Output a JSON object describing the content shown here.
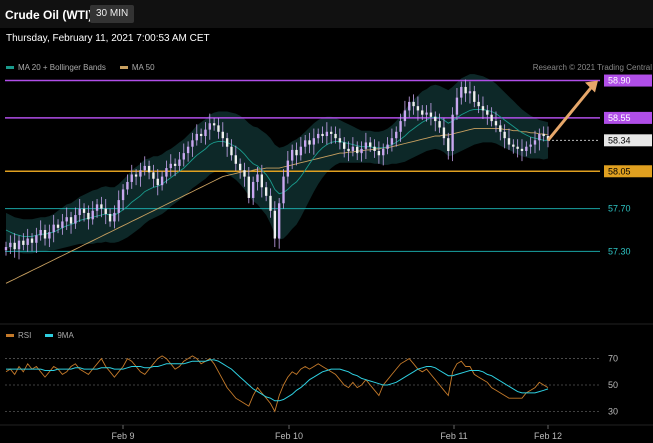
{
  "header": {
    "title": "Crude Oil (WTI)",
    "timeframe": "30 MIN"
  },
  "datetime": "Thursday, February 11, 2021 7:00:53 AM CET",
  "credit": "Research © 2021 Trading Central",
  "legend_main": [
    {
      "label": "MA 20 + Bollinger Bands",
      "color": "#1a9a8c"
    },
    {
      "label": "MA 50",
      "color": "#c8a060"
    }
  ],
  "legend_rsi": [
    {
      "label": "RSI",
      "color": "#c47a2a"
    },
    {
      "label": "9MA",
      "color": "#2ecfe0"
    }
  ],
  "colors": {
    "candle": "#c9a7f0",
    "resistance": "#b04ee8",
    "support_strong": "#e0a020",
    "support": "#1aa5a5",
    "target_arrow": "#e6a76a",
    "bands": "#0f2f2f"
  },
  "chart_data": [
    {
      "type": "candlestick",
      "x_ticks": [
        "Feb 9",
        "Feb 10",
        "Feb 11",
        "Feb 12"
      ],
      "ylim": [
        57.2,
        58.98
      ],
      "levels": [
        {
          "value": 58.9,
          "label": "58.90",
          "kind": "resistance"
        },
        {
          "value": 58.55,
          "label": "58.55",
          "kind": "resistance"
        },
        {
          "value": 58.05,
          "label": "58.05",
          "kind": "support_strong"
        },
        {
          "value": 57.7,
          "label": "57.70",
          "kind": "support"
        },
        {
          "value": 57.3,
          "label": "57.30",
          "kind": "support"
        }
      ],
      "last_price": {
        "value": 58.34,
        "label": "58.34"
      },
      "close": [
        57.34,
        57.38,
        57.32,
        57.4,
        57.36,
        57.42,
        57.38,
        57.45,
        57.5,
        57.42,
        57.48,
        57.55,
        57.52,
        57.58,
        57.62,
        57.56,
        57.64,
        57.7,
        57.66,
        57.6,
        57.68,
        57.74,
        57.7,
        57.65,
        57.58,
        57.66,
        57.78,
        57.88,
        57.95,
        58.02,
        58.0,
        58.06,
        58.1,
        58.04,
        57.98,
        57.92,
        58.0,
        58.08,
        58.12,
        58.1,
        58.16,
        58.22,
        58.28,
        58.34,
        58.4,
        58.38,
        58.44,
        58.5,
        58.48,
        58.42,
        58.36,
        58.28,
        58.2,
        58.12,
        58.06,
        58.0,
        57.8,
        57.95,
        58.02,
        57.9,
        57.82,
        57.68,
        57.42,
        57.75,
        58.0,
        58.15,
        58.25,
        58.2,
        58.28,
        58.34,
        58.3,
        58.36,
        58.4,
        58.38,
        58.42,
        58.4,
        58.36,
        58.32,
        58.26,
        58.24,
        58.28,
        58.22,
        58.26,
        58.32,
        58.28,
        58.24,
        58.2,
        58.26,
        58.3,
        58.36,
        58.42,
        58.52,
        58.62,
        58.7,
        58.66,
        58.62,
        58.58,
        58.6,
        58.56,
        58.52,
        58.46,
        58.36,
        58.24,
        58.58,
        58.74,
        58.84,
        58.78,
        58.8,
        58.7,
        58.66,
        58.62,
        58.58,
        58.52,
        58.48,
        58.42,
        58.36,
        58.3,
        58.28,
        58.26,
        58.24,
        58.28,
        58.3,
        58.34,
        58.4,
        58.38,
        58.34
      ],
      "ma20": [
        57.5,
        57.48,
        57.46,
        57.45,
        57.44,
        57.44,
        57.44,
        57.45,
        57.46,
        57.46,
        57.47,
        57.48,
        57.5,
        57.52,
        57.54,
        57.55,
        57.57,
        57.59,
        57.6,
        57.61,
        57.62,
        57.63,
        57.64,
        57.65,
        57.64,
        57.64,
        57.66,
        57.69,
        57.72,
        57.76,
        57.79,
        57.82,
        57.86,
        57.88,
        57.9,
        57.91,
        57.93,
        57.96,
        57.99,
        58.02,
        58.05,
        58.08,
        58.12,
        58.16,
        58.2,
        58.23,
        58.26,
        58.3,
        58.32,
        58.33,
        58.33,
        58.32,
        58.3,
        58.28,
        58.25,
        58.21,
        58.16,
        58.12,
        58.1,
        58.06,
        58.02,
        57.96,
        57.88,
        57.84,
        57.85,
        57.88,
        57.92,
        57.95,
        58.0,
        58.06,
        58.12,
        58.18,
        58.23,
        58.27,
        58.3,
        58.32,
        58.33,
        58.33,
        58.32,
        58.31,
        58.3,
        58.29,
        58.28,
        58.28,
        58.28,
        58.27,
        58.27,
        58.27,
        58.28,
        58.3,
        58.32,
        58.35,
        58.38,
        58.42,
        58.45,
        58.48,
        58.51,
        58.53,
        58.55,
        58.56,
        58.55,
        58.53,
        58.5,
        58.52,
        58.55,
        58.58,
        58.6,
        58.62,
        58.63,
        58.63,
        58.63,
        58.62,
        58.61,
        58.59,
        58.56,
        58.53,
        58.5,
        58.47,
        58.44,
        58.41,
        58.39,
        58.37,
        58.36,
        58.35,
        58.34,
        58.34
      ],
      "ma50": [
        57.0,
        57.02,
        57.04,
        57.06,
        57.08,
        57.1,
        57.12,
        57.14,
        57.16,
        57.18,
        57.2,
        57.22,
        57.24,
        57.26,
        57.28,
        57.3,
        57.32,
        57.34,
        57.36,
        57.38,
        57.4,
        57.42,
        57.44,
        57.46,
        57.48,
        57.5,
        57.52,
        57.54,
        57.56,
        57.58,
        57.6,
        57.62,
        57.64,
        57.66,
        57.68,
        57.7,
        57.72,
        57.74,
        57.76,
        57.78,
        57.8,
        57.82,
        57.84,
        57.86,
        57.88,
        57.9,
        57.92,
        57.94,
        57.96,
        57.98,
        58.0,
        58.01,
        58.02,
        58.03,
        58.04,
        58.05,
        58.05,
        58.06,
        58.07,
        58.07,
        58.08,
        58.08,
        58.08,
        58.08,
        58.09,
        58.1,
        58.11,
        58.12,
        58.13,
        58.14,
        58.15,
        58.16,
        58.17,
        58.18,
        58.19,
        58.2,
        58.21,
        58.22,
        58.22,
        58.23,
        58.23,
        58.24,
        58.24,
        58.25,
        58.25,
        58.26,
        58.26,
        58.27,
        58.27,
        58.28,
        58.29,
        58.3,
        58.31,
        58.32,
        58.33,
        58.34,
        58.35,
        58.36,
        58.37,
        58.38,
        58.38,
        58.39,
        58.39,
        58.4,
        58.41,
        58.42,
        58.43,
        58.44,
        58.45,
        58.45,
        58.45,
        58.45,
        58.45,
        58.45,
        58.45,
        58.44,
        58.44,
        58.43,
        58.43,
        58.42,
        58.42,
        58.41,
        58.41,
        58.4,
        58.4,
        58.39
      ],
      "band_width": [
        0.16,
        0.16,
        0.16,
        0.16,
        0.16,
        0.16,
        0.16,
        0.16,
        0.16,
        0.16,
        0.16,
        0.17,
        0.18,
        0.19,
        0.2,
        0.2,
        0.21,
        0.22,
        0.23,
        0.24,
        0.25,
        0.25,
        0.26,
        0.26,
        0.26,
        0.26,
        0.27,
        0.28,
        0.29,
        0.3,
        0.3,
        0.3,
        0.3,
        0.29,
        0.29,
        0.28,
        0.28,
        0.28,
        0.27,
        0.27,
        0.27,
        0.27,
        0.27,
        0.27,
        0.28,
        0.28,
        0.28,
        0.28,
        0.28,
        0.28,
        0.28,
        0.29,
        0.3,
        0.31,
        0.32,
        0.33,
        0.34,
        0.35,
        0.36,
        0.37,
        0.38,
        0.4,
        0.42,
        0.43,
        0.43,
        0.42,
        0.41,
        0.4,
        0.38,
        0.36,
        0.34,
        0.32,
        0.3,
        0.28,
        0.26,
        0.24,
        0.22,
        0.2,
        0.19,
        0.18,
        0.17,
        0.16,
        0.15,
        0.15,
        0.15,
        0.15,
        0.15,
        0.16,
        0.17,
        0.18,
        0.2,
        0.22,
        0.24,
        0.26,
        0.27,
        0.28,
        0.29,
        0.29,
        0.3,
        0.3,
        0.3,
        0.3,
        0.31,
        0.32,
        0.33,
        0.34,
        0.34,
        0.34,
        0.33,
        0.32,
        0.31,
        0.3,
        0.29,
        0.28,
        0.27,
        0.26,
        0.25,
        0.24,
        0.23,
        0.22,
        0.21,
        0.2,
        0.19,
        0.18,
        0.18,
        0.17
      ]
    },
    {
      "type": "line",
      "y_ticks": [
        70,
        50,
        30
      ],
      "ylim": [
        25,
        78
      ],
      "series": [
        {
          "name": "RSI",
          "values": [
            60,
            62,
            58,
            64,
            60,
            66,
            62,
            64,
            60,
            56,
            60,
            64,
            62,
            58,
            60,
            64,
            66,
            62,
            60,
            58,
            62,
            66,
            70,
            64,
            60,
            56,
            60,
            64,
            70,
            68,
            64,
            60,
            58,
            62,
            66,
            70,
            72,
            70,
            66,
            62,
            64,
            68,
            70,
            72,
            70,
            66,
            68,
            70,
            66,
            60,
            54,
            48,
            44,
            40,
            38,
            36,
            34,
            42,
            48,
            44,
            40,
            36,
            30,
            42,
            50,
            56,
            60,
            58,
            62,
            64,
            62,
            64,
            66,
            64,
            62,
            60,
            58,
            54,
            50,
            48,
            52,
            48,
            50,
            54,
            50,
            46,
            42,
            50,
            54,
            58,
            62,
            66,
            68,
            70,
            66,
            62,
            60,
            62,
            58,
            54,
            50,
            46,
            42,
            60,
            66,
            68,
            64,
            64,
            58,
            56,
            54,
            52,
            48,
            46,
            44,
            42,
            40,
            40,
            40,
            40,
            44,
            46,
            48,
            52,
            50,
            48
          ]
        },
        {
          "name": "9MA",
          "values": [
            62,
            62,
            62,
            62,
            62,
            62,
            62,
            62,
            62,
            61,
            61,
            61,
            62,
            62,
            62,
            62,
            63,
            63,
            62,
            62,
            62,
            62,
            63,
            63,
            63,
            62,
            62,
            62,
            63,
            64,
            64,
            64,
            63,
            63,
            64,
            64,
            65,
            66,
            66,
            66,
            66,
            66,
            67,
            68,
            68,
            68,
            68,
            69,
            69,
            68,
            66,
            64,
            62,
            59,
            56,
            53,
            50,
            47,
            45,
            43,
            41,
            40,
            38,
            38,
            39,
            41,
            43,
            46,
            48,
            51,
            54,
            56,
            58,
            60,
            61,
            62,
            62,
            62,
            61,
            60,
            58,
            57,
            55,
            54,
            53,
            52,
            51,
            50,
            50,
            51,
            52,
            54,
            56,
            58,
            60,
            62,
            63,
            64,
            64,
            63,
            61,
            59,
            57,
            57,
            58,
            59,
            60,
            61,
            61,
            61,
            60,
            58,
            57,
            55,
            53,
            51,
            49,
            47,
            45,
            44,
            44,
            44,
            44,
            45,
            46,
            47
          ]
        }
      ]
    },
    {
      "type": "x_axis",
      "tick_labels": [
        "Feb 9",
        "Feb 10",
        "Feb 11",
        "Feb 12"
      ]
    }
  ]
}
